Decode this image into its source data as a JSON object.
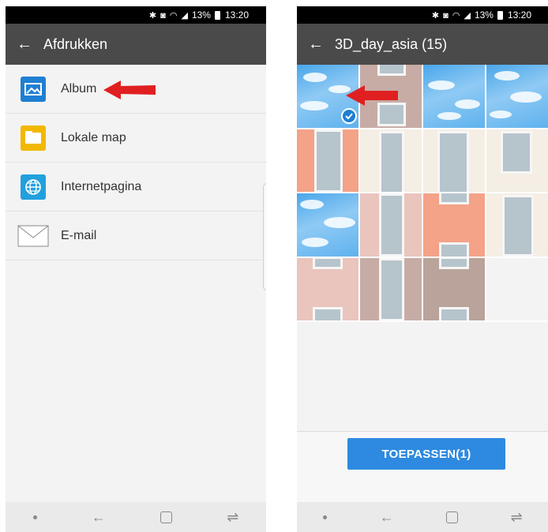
{
  "left_screen": {
    "status_bar": {
      "battery": "13%",
      "time": "13:20"
    },
    "app_bar": {
      "title": "Afdrukken"
    },
    "menu_items": [
      {
        "label": "Album",
        "icon": "album-icon"
      },
      {
        "label": "Lokale map",
        "icon": "folder-icon"
      },
      {
        "label": "Internetpagina",
        "icon": "globe-icon"
      },
      {
        "label": "E-mail",
        "icon": "mail-icon"
      }
    ]
  },
  "right_screen": {
    "status_bar": {
      "battery": "13%",
      "time": "13:20"
    },
    "app_bar": {
      "title": "3D_day_asia (15)"
    },
    "apply_button": {
      "label": "TOEPASSEN(1)"
    },
    "selected_count": 1
  },
  "colors": {
    "app_bar": "#4a4a4a",
    "accent": "#2e8ae0",
    "arrow": "#e02020"
  }
}
